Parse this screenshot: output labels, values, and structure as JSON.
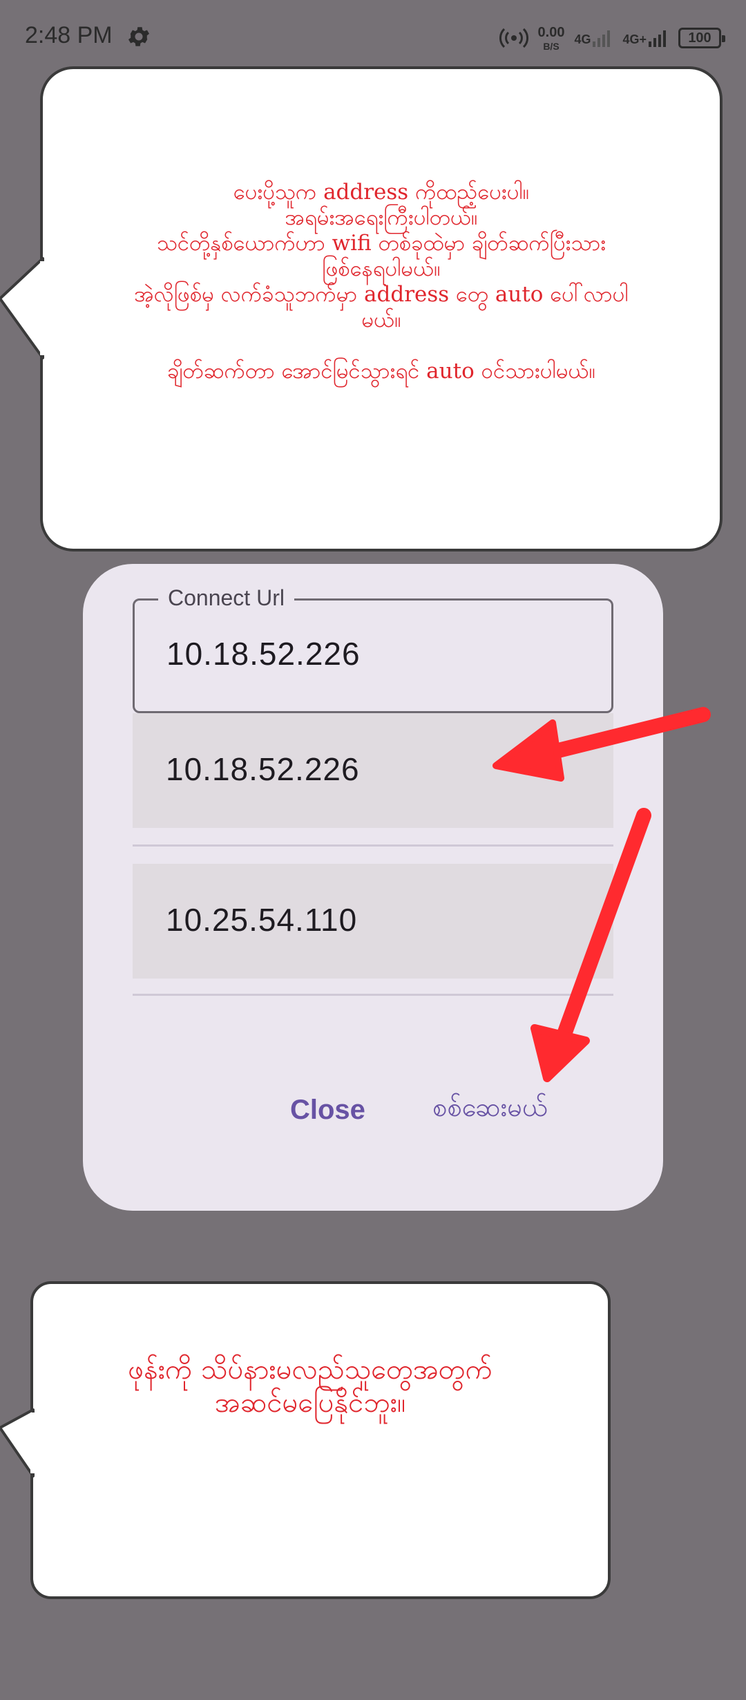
{
  "status_bar": {
    "time": "2:48 PM",
    "settings_icon": "gear-icon",
    "hotspot_icon": "hotspot-icon",
    "speed_value": "0.00",
    "speed_unit": "B/S",
    "network_1": "4G",
    "network_2": "4G+",
    "battery": "100"
  },
  "bubble_top": {
    "text": "ပေးပို့သူက address ကိုထည့်ပေးပါ။\nအရမ်းအရေးကြီးပါတယ်။\nသင်တို့နှစ်ယောက်ဟာ wifi တစ်ခုထဲမှာ ချိတ်ဆက်ပြီးသား\nဖြစ်နေရပါမယ်။\nအဲ့လိုဖြစ်မှ လက်ခံသူဘက်မှာ address တွေ auto ပေါ်လာပါ\nမယ်။\n\nချိတ်ဆက်တာ အောင်မြင်သွားရင် auto ဝင်သားပါမယ်။"
  },
  "dialog": {
    "field_label": "Connect Url",
    "field_value": "10.18.52.226",
    "options": [
      "10.18.52.226",
      "10.25.54.110"
    ],
    "close_label": "Close",
    "check_label": "စစ်ဆေးမယ်"
  },
  "bubble_bottom": {
    "text": "ဖုန်းကို သိပ်နားမလည်သူတွေအတွက်\nအဆင်မပြေနိုင်ဘူး။"
  },
  "colors": {
    "annotation_red": "#e0262d",
    "accent_purple": "#6752a4",
    "dialog_bg": "#ebe6ef",
    "scrim": "#767176"
  }
}
